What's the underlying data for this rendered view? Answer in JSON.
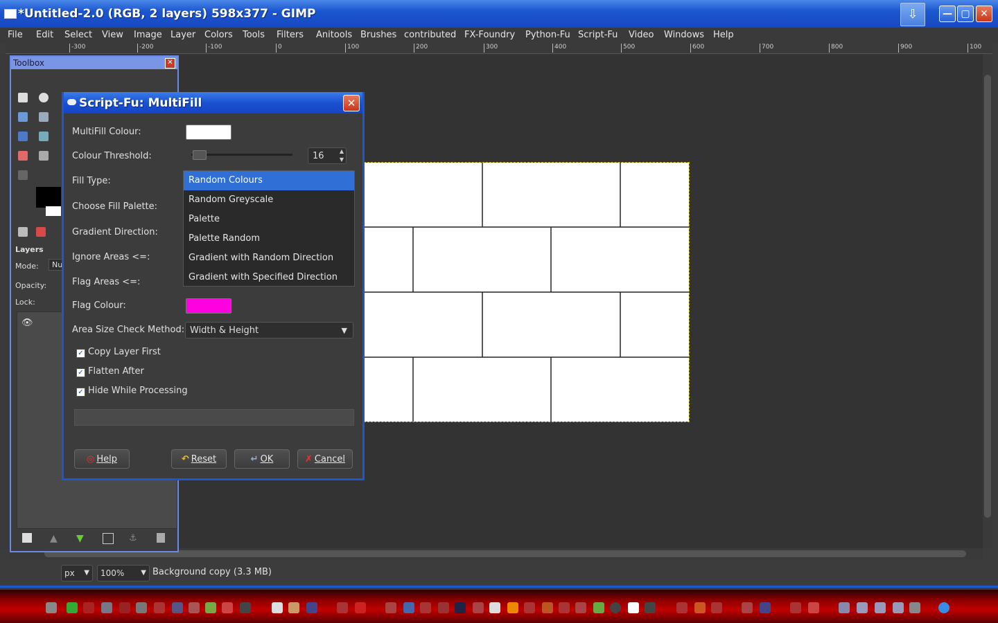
{
  "window": {
    "title": "*Untitled-2.0 (RGB, 2 layers) 598x377 - GIMP",
    "minimize": "—",
    "maximize": "▢",
    "close": "✕",
    "download": "⇩"
  },
  "menu": [
    "File",
    "Edit",
    "Select",
    "View",
    "Image",
    "Layer",
    "Colors",
    "Tools",
    "Filters",
    "Anitools",
    "Brushes",
    "contributed",
    "FX-Foundry",
    "Python-Fu",
    "Script-Fu",
    "Video",
    "Windows",
    "Help"
  ],
  "ruler_ticks": [
    "-300",
    "-200",
    "-100",
    "0",
    "100",
    "200",
    "300",
    "400",
    "500",
    "600",
    "700",
    "800",
    "900",
    "100"
  ],
  "toolbox": {
    "title": "Toolbox",
    "layers_label": "Layers",
    "mode_label": "Mode:",
    "mode_value": "Nu",
    "opacity_label": "Opacity:",
    "lock_label": "Lock:"
  },
  "dialog": {
    "title": "Script-Fu: MultiFill",
    "fields": {
      "multifill_colour": "MultiFill Colour:",
      "colour_threshold": "Colour Threshold:",
      "fill_type": "Fill Type:",
      "choose_fill_palette": "Choose Fill Palette:",
      "gradient_direction": "Gradient Direction:",
      "ignore_areas": "Ignore Areas <=:",
      "flag_areas": "Flag Areas <=:",
      "flag_colour": "Flag Colour:",
      "area_size_check": "Area Size Check Method:"
    },
    "multifill_colour_hex": "#ffffff",
    "flag_colour_hex": "#ff00e0",
    "threshold_value": "16",
    "fill_type_options": [
      "Random Colours",
      "Random Greyscale",
      "Palette",
      "Palette Random",
      "Gradient with Random Direction",
      "Gradient with Specified Direction"
    ],
    "fill_type_selected": "Random Colours",
    "area_size_check_value": "Width & Height",
    "checkboxes": [
      {
        "label": "Copy Layer First",
        "checked": true
      },
      {
        "label": "Flatten After",
        "checked": true
      },
      {
        "label": "Hide While Processing",
        "checked": true
      }
    ],
    "buttons": {
      "help": "Help",
      "reset": "Reset",
      "ok": "OK",
      "cancel": "Cancel"
    }
  },
  "status": {
    "unit": "px",
    "zoom": "100",
    "zoom_suffix": "%",
    "text": "Background copy (3.3 MB)"
  },
  "colors": {
    "accent": "#1c56d0",
    "selection": "#2f6fd6",
    "flag": "#ff00e0"
  }
}
